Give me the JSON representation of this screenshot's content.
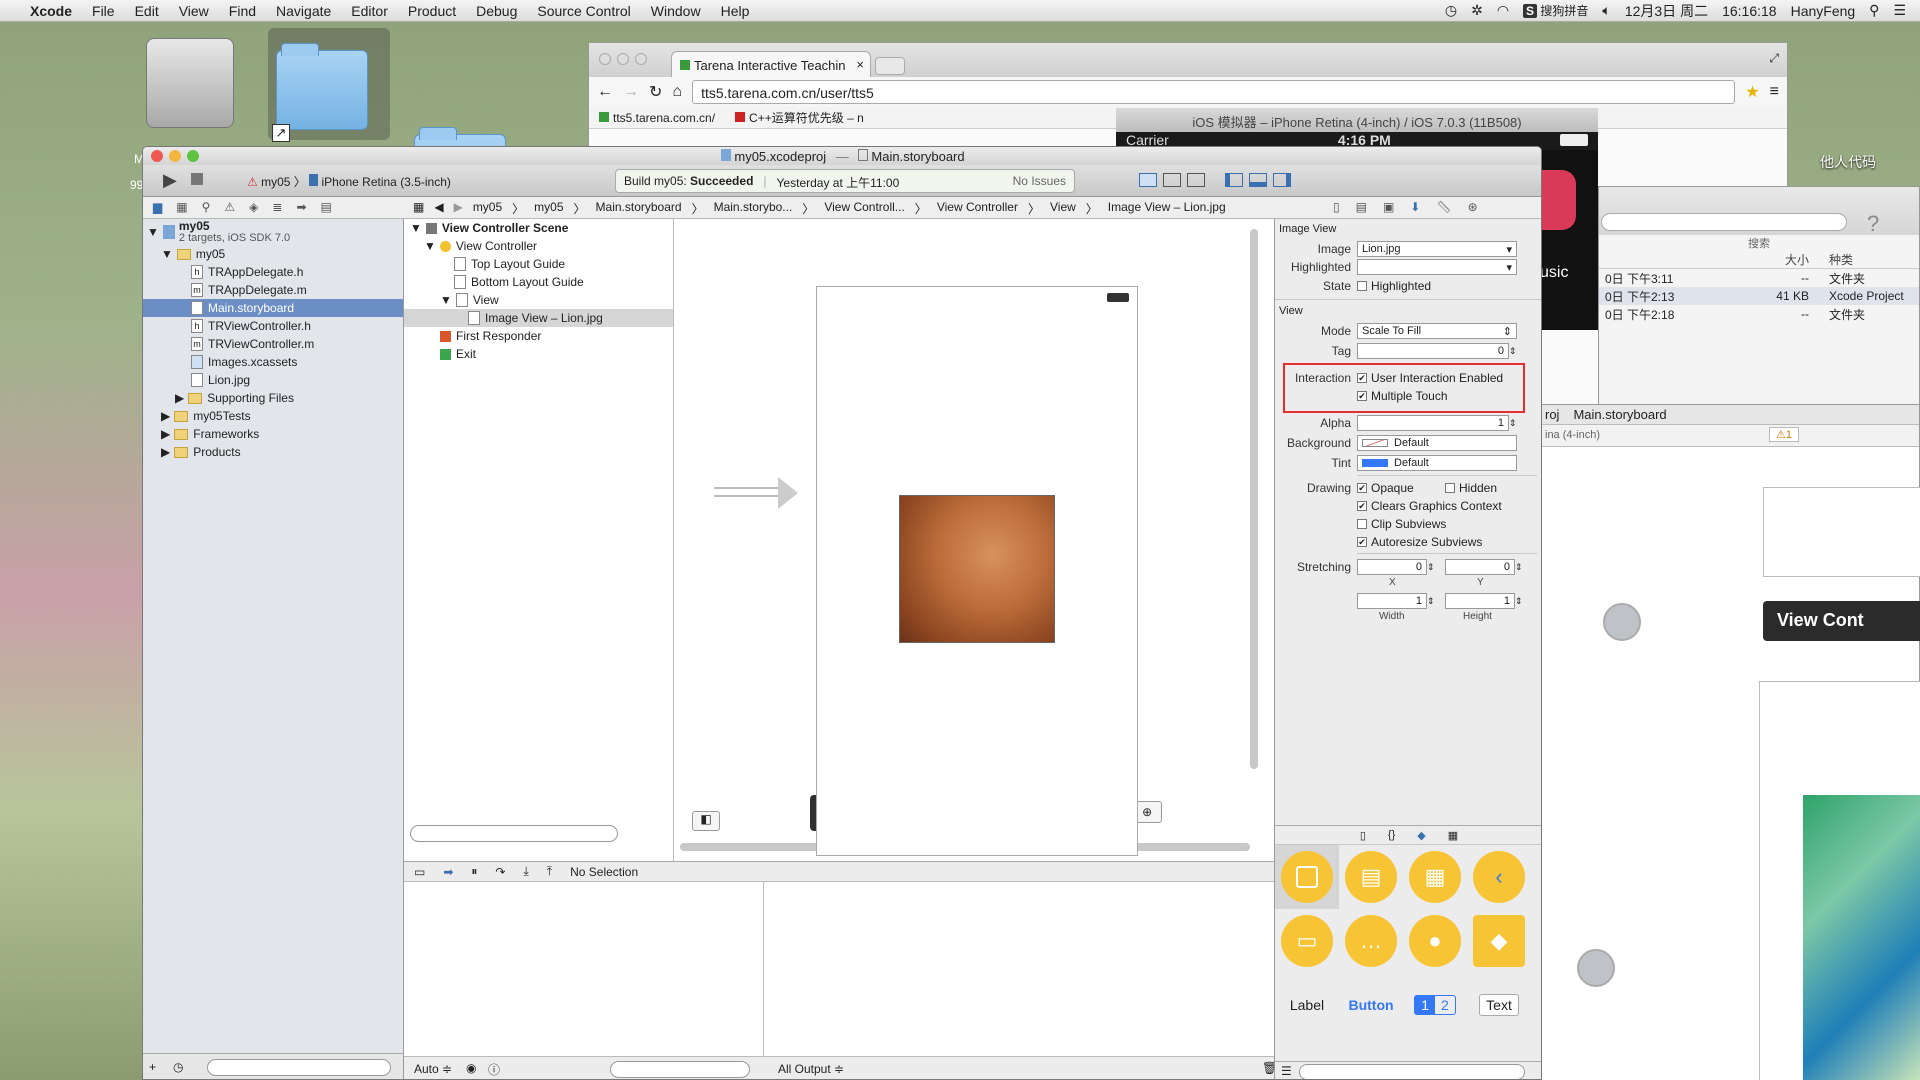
{
  "menubar": {
    "apple": "",
    "app": "Xcode",
    "items": [
      "File",
      "Edit",
      "View",
      "Find",
      "Navigate",
      "Editor",
      "Product",
      "Debug",
      "Source Control",
      "Window",
      "Help"
    ],
    "ime": "搜狗拼音",
    "date": "12月3日 周二",
    "time": "16:16:18",
    "user": "HanyFeng"
  },
  "desktop": {
    "right_folder_label": "他人代码",
    "left_partial_a": "M",
    "left_partial_b": "99"
  },
  "browser": {
    "tab_title": "Tarena Interactive Teachin",
    "url": "tts5.tarena.com.cn/user/tts5",
    "bookmarks": [
      "tts5.tarena.com.cn/",
      "C++运算符优先级 – n"
    ]
  },
  "simulator": {
    "title": "iOS 模拟器 – iPhone Retina (4-inch) / iOS 7.0.3 (11B508)",
    "carrier": "Carrier",
    "clock": "4:16 PM",
    "music": "usic"
  },
  "finder": {
    "search": "搜索",
    "col_size": "大小",
    "col_kind": "种类",
    "rows": [
      {
        "date": "0日 下午3:11",
        "size": "--",
        "kind": "文件夹"
      },
      {
        "date": "0日 下午2:13",
        "size": "41 KB",
        "kind": "Xcode Project"
      },
      {
        "date": "0日 下午2:18",
        "size": "--",
        "kind": "文件夹"
      }
    ]
  },
  "bg_xcode": {
    "crumb_a": "roj",
    "crumb_b": "Main.storyboard",
    "device": "ina (4-inch)",
    "warning": "1",
    "vc_title": "View Cont"
  },
  "xcode": {
    "window_title_proj": "my05.xcodeproj",
    "window_title_file": "Main.storyboard",
    "scheme": "my05",
    "device": "iPhone Retina (3.5-inch)",
    "status_build": "Build my05: ",
    "status_result": "Succeeded",
    "status_time": "Yesterday at 上午11:00",
    "status_issues": "No Issues",
    "jumpbar": [
      "my05",
      "my05",
      "Main.storyboard",
      "Main.storybo...",
      "View Controll...",
      "View Controller",
      "View",
      "Image View – Lion.jpg"
    ],
    "navigator": {
      "project": "my05",
      "project_sub": "2 targets, iOS SDK 7.0",
      "group": "my05",
      "files": [
        {
          "name": "TRAppDelegate.h",
          "icon": "h"
        },
        {
          "name": "TRAppDelegate.m",
          "icon": "m"
        },
        {
          "name": "Main.storyboard",
          "icon": "sb",
          "selected": true
        },
        {
          "name": "TRViewController.h",
          "icon": "h"
        },
        {
          "name": "TRViewController.m",
          "icon": "m"
        },
        {
          "name": "Images.xcassets",
          "icon": "xa"
        },
        {
          "name": "Lion.jpg",
          "icon": "img"
        }
      ],
      "supporting": "Supporting Files",
      "groups": [
        "my05Tests",
        "Frameworks",
        "Products"
      ]
    },
    "outline": {
      "scene": "View Controller Scene",
      "vc": "View Controller",
      "top_guide": "Top Layout Guide",
      "bottom_guide": "Bottom Layout Guide",
      "view": "View",
      "image_view": "Image View – Lion.jpg",
      "first_responder": "First Responder",
      "exit": "Exit"
    },
    "debug": {
      "no_selection": "No Selection",
      "auto": "Auto ≑",
      "all_output": "All Output ≑"
    },
    "inspector": {
      "section_image": "Image View",
      "image_label": "Image",
      "image_value": "Lion.jpg",
      "highlighted_label": "Highlighted",
      "highlighted_value": "",
      "state_label": "State",
      "state_value": "Highlighted",
      "section_view": "View",
      "mode_label": "Mode",
      "mode_value": "Scale To Fill",
      "tag_label": "Tag",
      "tag_value": "0",
      "interaction_label": "Interaction",
      "user_interaction": "User Interaction Enabled",
      "multiple_touch": "Multiple Touch",
      "alpha_label": "Alpha",
      "alpha_value": "1",
      "background_label": "Background",
      "background_value": "Default",
      "tint_label": "Tint",
      "tint_value": "Default",
      "drawing_label": "Drawing",
      "opaque": "Opaque",
      "hidden": "Hidden",
      "clears": "Clears Graphics Context",
      "clip": "Clip Subviews",
      "autoresize": "Autoresize Subviews",
      "stretching_label": "Stretching",
      "x_value": "0",
      "y_value": "0",
      "x_label": "X",
      "y_label": "Y",
      "w_value": "1",
      "h_value": "1",
      "w_label": "Width",
      "h_label": "Height"
    },
    "library": {
      "label": "Label",
      "button": "Button",
      "seg1": "1",
      "seg2": "2",
      "text": "Text"
    },
    "colors": {
      "accent": "#3478f6",
      "highlight_box": "#e03030",
      "selection": "#6b8fc4"
    }
  }
}
